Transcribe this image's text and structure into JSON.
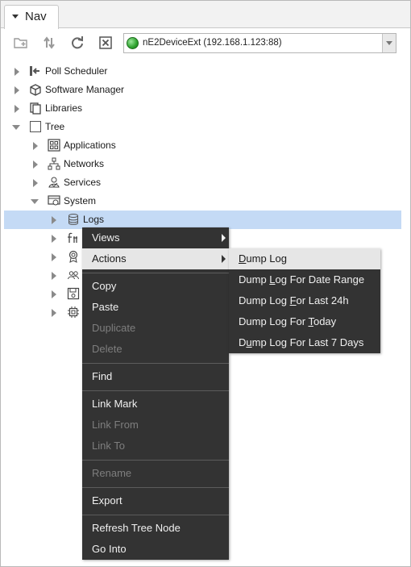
{
  "nav": {
    "tab_label": "Nav"
  },
  "toolbar": {
    "buttons": [
      "new-folder-icon",
      "sync-arrows-icon",
      "refresh-icon",
      "close-box-icon"
    ],
    "station": "nE2DeviceExt (192.168.1.123:88)",
    "station_status_color": "#2ea12e"
  },
  "tree": {
    "items": [
      {
        "label": "Poll Scheduler",
        "icon": "poll-scheduler-icon",
        "state": "collapsed"
      },
      {
        "label": "Software Manager",
        "icon": "software-manager-icon",
        "state": "collapsed"
      },
      {
        "label": "Libraries",
        "icon": "libraries-icon",
        "state": "collapsed"
      },
      {
        "label": "Tree",
        "icon": "tree-icon",
        "state": "expanded"
      },
      {
        "label": "Applications",
        "icon": "applications-icon",
        "state": "collapsed"
      },
      {
        "label": "Networks",
        "icon": "networks-icon",
        "state": "collapsed"
      },
      {
        "label": "Services",
        "icon": "services-icon",
        "state": "collapsed"
      },
      {
        "label": "System",
        "icon": "system-icon",
        "state": "expanded"
      },
      {
        "label": "Logs",
        "icon": "database-icon",
        "state": "collapsed",
        "selected": true
      }
    ],
    "hidden_child_icons": [
      "function-icon",
      "badge-icon",
      "users-icon",
      "save-icon",
      "chip-icon"
    ]
  },
  "context_menu": {
    "views": "Views",
    "actions": "Actions",
    "copy": "Copy",
    "paste": "Paste",
    "duplicate": "Duplicate",
    "delete": "Delete",
    "find": "Find",
    "link_mark": "Link Mark",
    "link_from": "Link From",
    "link_to": "Link To",
    "rename": "Rename",
    "export": "Export",
    "refresh_tree_node": "Refresh Tree Node",
    "go_into": "Go Into"
  },
  "actions_submenu": {
    "dump_log": {
      "pre": "",
      "key": "D",
      "post": "ump Log"
    },
    "dump_log_date_range": {
      "pre": "Dump ",
      "key": "L",
      "post": "og For Date Range"
    },
    "dump_log_last_24h": {
      "pre": "Dump Log ",
      "key": "F",
      "post": "or Last 24h"
    },
    "dump_log_today": {
      "pre": "Dump Log For ",
      "key": "T",
      "post": "oday"
    },
    "dump_log_last_7_days": {
      "pre": "D",
      "key": "u",
      "post": "mp Log For Last 7 Days"
    }
  },
  "colors": {
    "menu_bg": "#333333",
    "menu_highlight": "#e6e6e6",
    "selection": "#c4daf5"
  }
}
